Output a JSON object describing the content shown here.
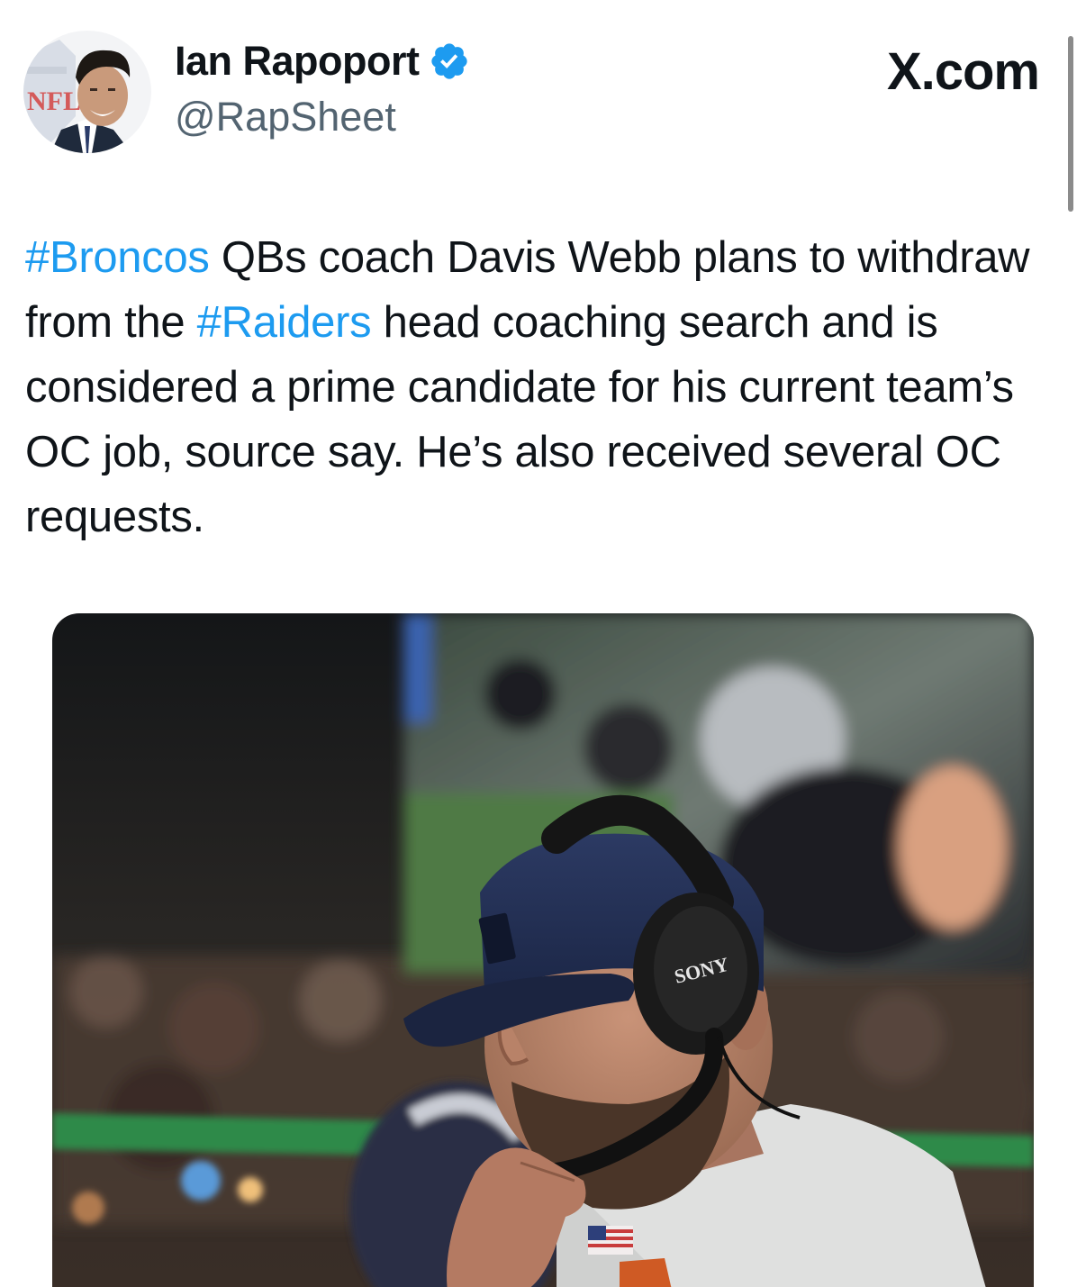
{
  "header": {
    "display_name": "Ian Rapoport",
    "handle": "@RapSheet",
    "brand": "X.com",
    "avatar_badge_text": "NFL"
  },
  "tweet": {
    "segments": [
      {
        "text": "#Broncos",
        "hashtag": true
      },
      {
        "text": " QBs coach Davis Webb plans to withdraw from the ",
        "hashtag": false
      },
      {
        "text": "#Raiders",
        "hashtag": true
      },
      {
        "text": " head coaching search and is considered a prime candidate for his current team’s OC job, source say. He’s also received several OC requests.",
        "hashtag": false
      }
    ]
  },
  "photo": {
    "headphone_brand": "SONY"
  },
  "colors": {
    "link": "#1d9bf0",
    "text": "#0f1419",
    "secondary": "#536471",
    "verified": "#1d9bf0"
  },
  "icons": {
    "verified": "verified-badge-icon"
  }
}
